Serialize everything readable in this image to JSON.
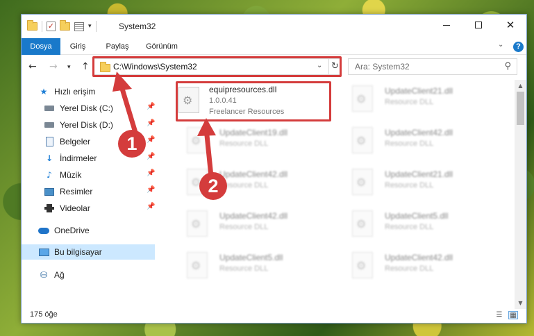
{
  "window": {
    "title": "System32"
  },
  "ribbon": {
    "tabs": [
      "Dosya",
      "Giriş",
      "Paylaş",
      "Görünüm"
    ],
    "help": "?"
  },
  "nav": {
    "address": "C:\\Windows\\System32",
    "search_placeholder": "Ara: System32"
  },
  "sidebar": {
    "items": [
      {
        "label": "Hızlı erişim"
      },
      {
        "label": "Yerel Disk (C:)"
      },
      {
        "label": "Yerel Disk (D:)"
      },
      {
        "label": "Belgeler"
      },
      {
        "label": "İndirmeler"
      },
      {
        "label": "Müzik"
      },
      {
        "label": "Resimler"
      },
      {
        "label": "Videolar"
      },
      {
        "label": "OneDrive"
      },
      {
        "label": "Bu bilgisayar"
      },
      {
        "label": "Ağ"
      }
    ]
  },
  "files": {
    "highlighted": {
      "name": "equipresources.dll",
      "version": "1.0.0.41",
      "company": "Freelancer Resources"
    },
    "others": [
      {
        "name": "UpdateClient21.dll",
        "desc": "Resource DLL"
      },
      {
        "name": "UpdateClient19.dll",
        "desc": "Resource DLL"
      },
      {
        "name": "UpdateClient42.dll",
        "desc": "Resource DLL"
      },
      {
        "name": "UpdateClient42.dll",
        "desc": "Resource DLL"
      },
      {
        "name": "UpdateClient21.dll",
        "desc": "Resource DLL"
      },
      {
        "name": "UpdateClient42.dll",
        "desc": "Resource DLL"
      },
      {
        "name": "UpdateClient5.dll",
        "desc": "Resource DLL"
      },
      {
        "name": "UpdateClient5.dll",
        "desc": "Resource DLL"
      },
      {
        "name": "UpdateClient42.dll",
        "desc": "Resource DLL"
      }
    ]
  },
  "status": {
    "item_count": "175 öğe"
  },
  "annotations": {
    "step1": "1",
    "step2": "2",
    "color": "#d43c3c"
  }
}
